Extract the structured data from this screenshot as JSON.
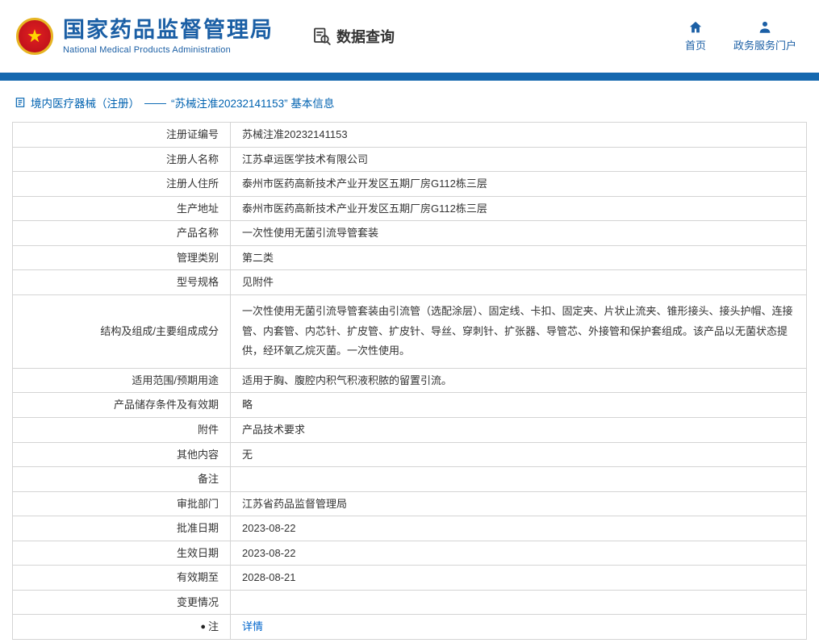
{
  "colors": {
    "header_blue": "#1b5fa5",
    "bar_blue": "#1568af",
    "link_blue": "#0066cc",
    "border_gray": "#d4d4d4"
  },
  "header": {
    "org_name_cn": "国家药品监督管理局",
    "org_name_en": "National Medical Products Administration",
    "nav_query": "数据查询",
    "nav_home": "首页",
    "nav_portal": "政务服务门户"
  },
  "breadcrumb": {
    "section": "境内医疗器械（注册）",
    "separator": "——",
    "title": "“苏械注准20232141153” 基本信息"
  },
  "table": {
    "rows": [
      {
        "label": "注册证编号",
        "value": "苏械注准20232141153"
      },
      {
        "label": "注册人名称",
        "value": "江苏卓运医学技术有限公司"
      },
      {
        "label": "注册人住所",
        "value": "泰州市医药高新技术产业开发区五期厂房G112栋三层"
      },
      {
        "label": "生产地址",
        "value": "泰州市医药高新技术产业开发区五期厂房G112栋三层"
      },
      {
        "label": "产品名称",
        "value": "一次性使用无菌引流导管套装"
      },
      {
        "label": "管理类别",
        "value": "第二类"
      },
      {
        "label": "型号规格",
        "value": "见附件"
      },
      {
        "label": "结构及组成/主要组成成分",
        "value": "一次性使用无菌引流导管套装由引流管（选配涂层）、固定线、卡扣、固定夹、片状止流夹、锥形接头、接头护帽、连接管、内套管、内芯针、扩皮管、扩皮针、导丝、穿刺针、扩张器、导管芯、外接管和保护套组成。该产品以无菌状态提供，经环氧乙烷灭菌。一次性使用。",
        "tall": true
      },
      {
        "label": "适用范围/预期用途",
        "value": "适用于胸、腹腔内积气积液积脓的留置引流。"
      },
      {
        "label": "产品储存条件及有效期",
        "value": "略"
      },
      {
        "label": "附件",
        "value": "产品技术要求"
      },
      {
        "label": "其他内容",
        "value": "无"
      },
      {
        "label": "备注",
        "value": ""
      },
      {
        "label": "审批部门",
        "value": "江苏省药品监督管理局"
      },
      {
        "label": "批准日期",
        "value": "2023-08-22"
      },
      {
        "label": "生效日期",
        "value": "2023-08-22"
      },
      {
        "label": "有效期至",
        "value": "2028-08-21"
      },
      {
        "label": "变更情况",
        "value": ""
      },
      {
        "label": "注",
        "value": "详情",
        "link": true,
        "icon": true,
        "icon_glyph": "●"
      }
    ]
  }
}
